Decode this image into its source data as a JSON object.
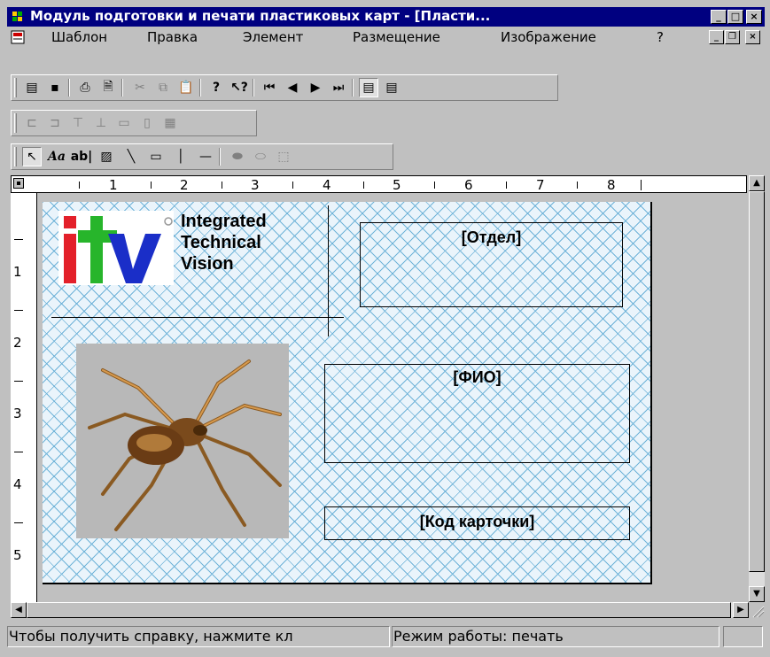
{
  "window": {
    "title": "Модуль подготовки и печати пластиковых карт - [Пласти...",
    "minimize_glyph": "_",
    "maximize_glyph": "□",
    "close_glyph": "×"
  },
  "menu": {
    "items": [
      "Шаблон",
      "Правка",
      "Элемент",
      "Размещение",
      "Изображение",
      "?"
    ],
    "mdi_min_glyph": "_",
    "mdi_restore_glyph": "❐",
    "mdi_close_glyph": "×"
  },
  "toolbar_main": {
    "buttons": [
      {
        "name": "new-template",
        "glyph": "▤"
      },
      {
        "name": "save",
        "glyph": "▪"
      },
      {
        "name": "print",
        "glyph": "⎙"
      },
      {
        "name": "print-preview",
        "glyph": "🗎"
      },
      {
        "name": "cut",
        "glyph": "✂"
      },
      {
        "name": "copy",
        "glyph": "⧉"
      },
      {
        "name": "paste",
        "glyph": "📋"
      },
      {
        "name": "help",
        "glyph": "?"
      },
      {
        "name": "context-help",
        "glyph": "↖?"
      },
      {
        "name": "first",
        "glyph": "⏮"
      },
      {
        "name": "prev",
        "glyph": "◀"
      },
      {
        "name": "next",
        "glyph": "▶"
      },
      {
        "name": "last",
        "glyph": "⏭"
      },
      {
        "name": "page-front",
        "glyph": "▤"
      },
      {
        "name": "page-back",
        "glyph": "▤"
      }
    ]
  },
  "toolbar_align": {
    "buttons": [
      "⊏",
      "⊐",
      "⊤",
      "⊥",
      "▭",
      "▯",
      "▦"
    ]
  },
  "toolbar_elements": {
    "pointer_glyph": "↖",
    "text_glyph": "Aa",
    "field_glyph": "ab|",
    "image_glyph": "▨",
    "line_glyph": "╲",
    "rect_glyph": "▭",
    "vline_glyph": "│",
    "hline_glyph": "—",
    "extra_glyphs": [
      "⬬",
      "⬭",
      "⬚"
    ]
  },
  "ruler": {
    "h_numbers": [
      "1",
      "2",
      "3",
      "4",
      "5",
      "6",
      "7",
      "8"
    ],
    "v_numbers": [
      "1",
      "2",
      "3",
      "4",
      "5"
    ]
  },
  "card": {
    "logo_letters": "itV",
    "logo_text": [
      "Integrated",
      "Technical",
      "Vision"
    ],
    "field_department": "[Отдел]",
    "field_name": "[ФИО]",
    "field_card_code": "[Код карточки]"
  },
  "status": {
    "help_text": "Чтобы получить справку, нажмите кл",
    "mode_text": "Режим работы:  печать"
  },
  "colors": {
    "titlebar": "#000080",
    "logo_red": "#e3202a",
    "logo_green": "#27b52b",
    "logo_blue": "#1a2ec8",
    "pattern": "#6fb3d8"
  }
}
